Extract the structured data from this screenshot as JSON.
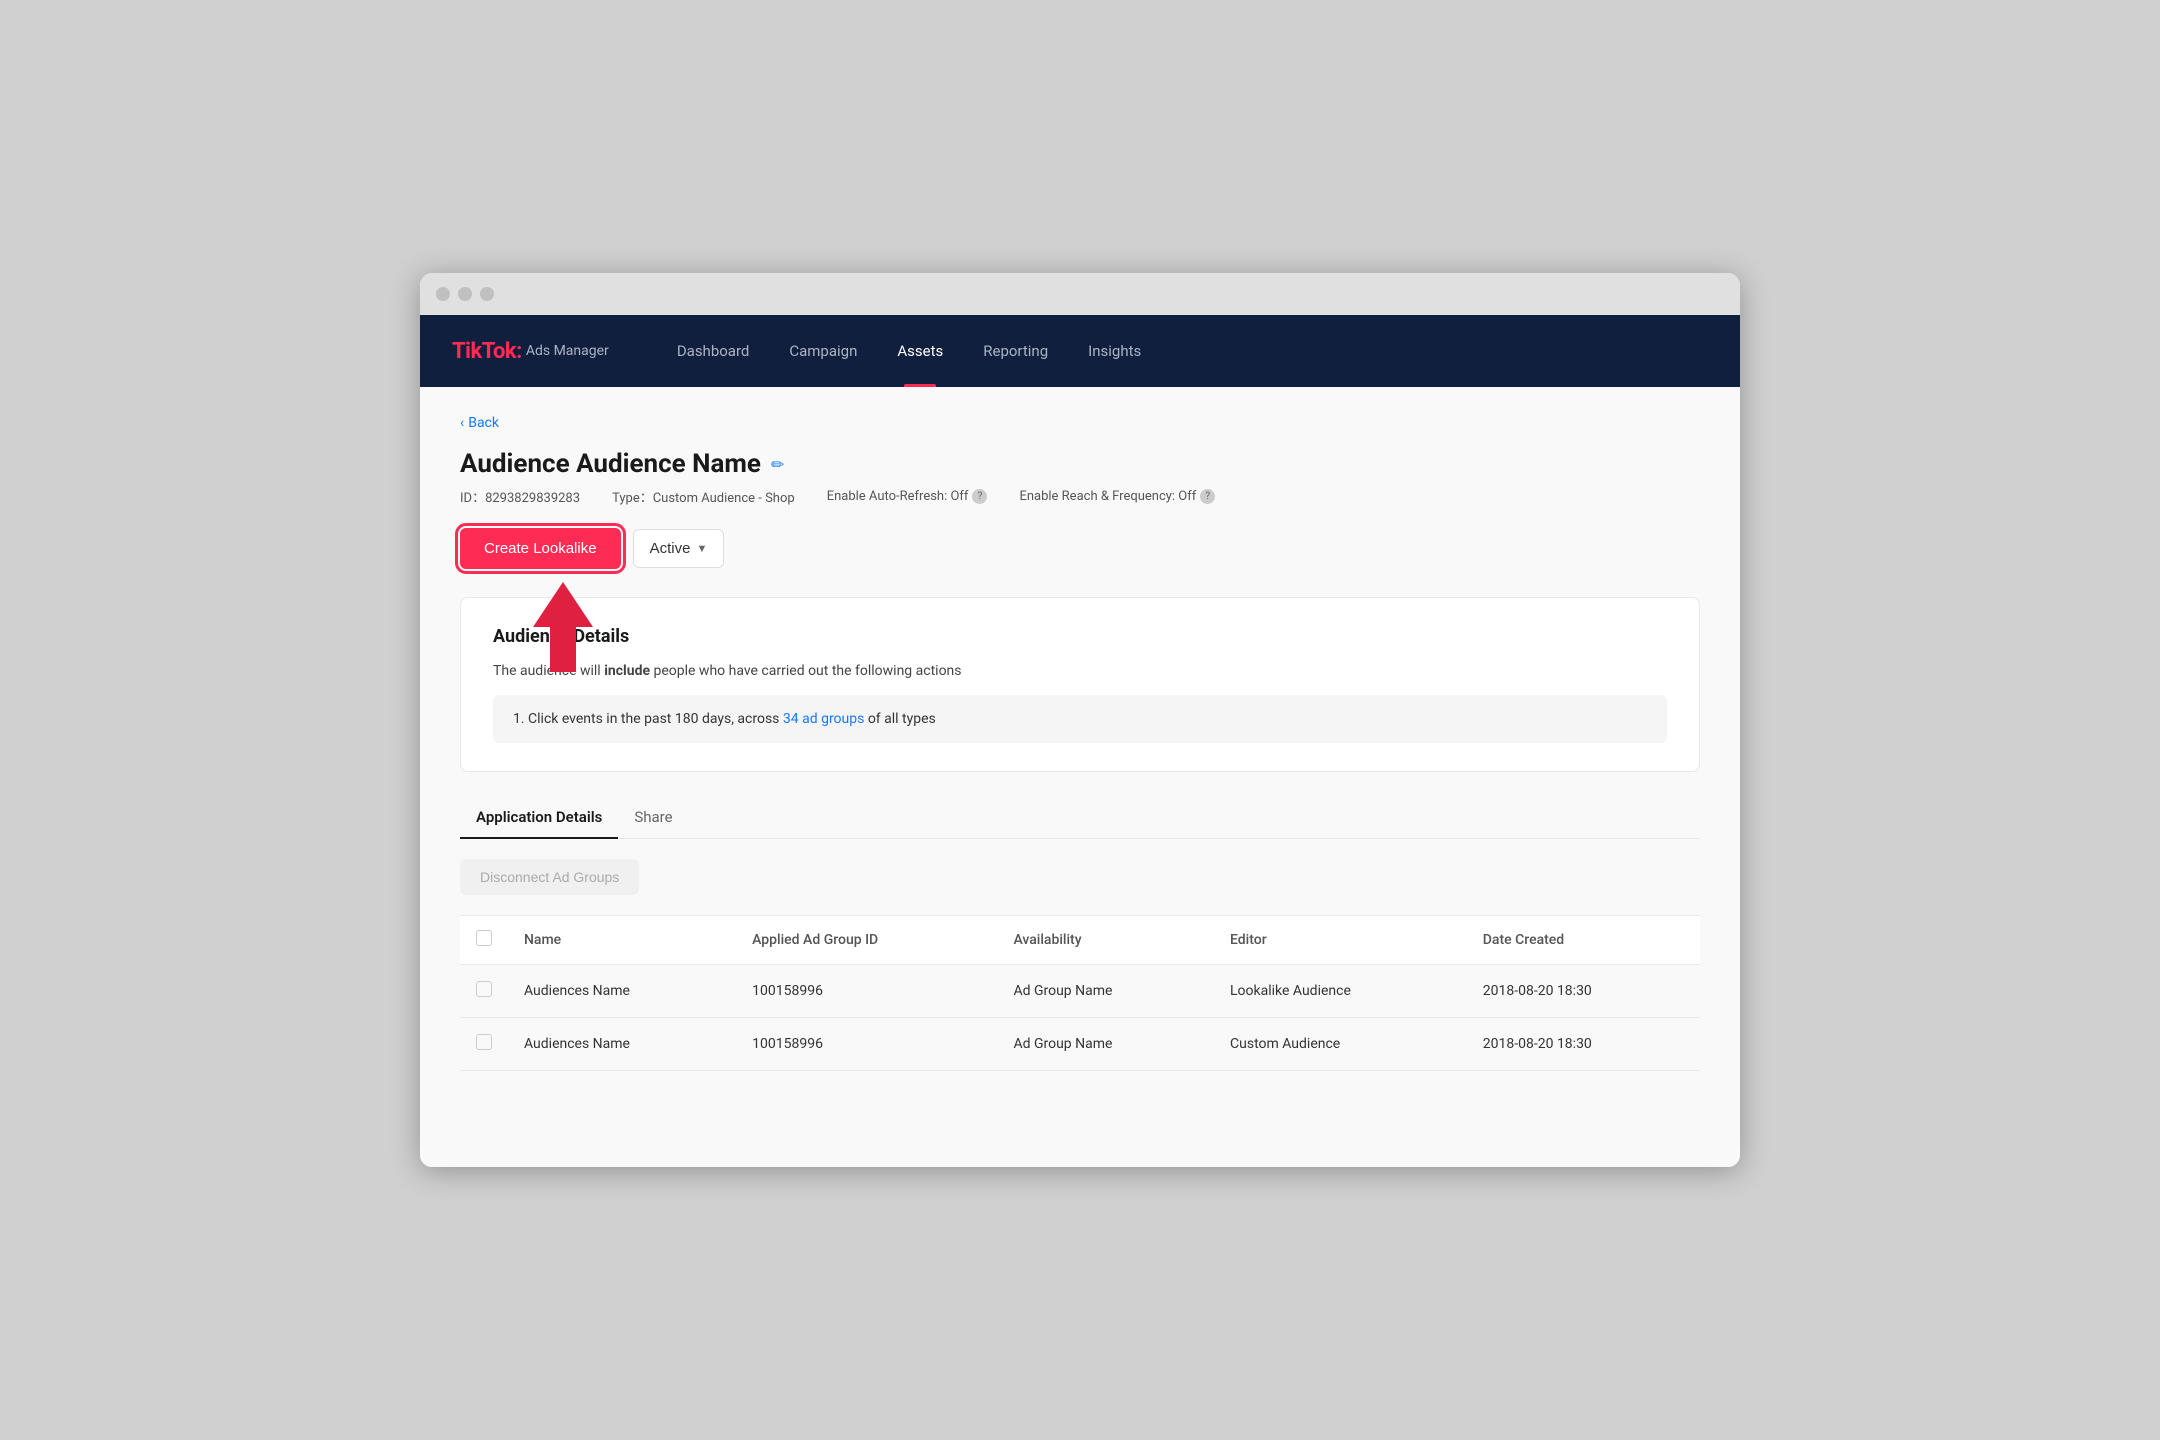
{
  "browser": {
    "traffic_lights": [
      "close",
      "minimize",
      "maximize"
    ]
  },
  "nav": {
    "logo": "TikTok",
    "logo_colon": ":",
    "logo_sub": "Ads Manager",
    "items": [
      {
        "label": "Dashboard",
        "active": false
      },
      {
        "label": "Campaign",
        "active": false
      },
      {
        "label": "Assets",
        "active": true
      },
      {
        "label": "Reporting",
        "active": false
      },
      {
        "label": "Insights",
        "active": false
      }
    ]
  },
  "page": {
    "back_label": "Back",
    "title": "Audience Audience Name",
    "edit_icon": "✏",
    "id_label": "ID：8293829839283",
    "type_label": "Type：Custom Audience - Shop",
    "auto_refresh_label": "Enable Auto-Refresh: Off",
    "reach_frequency_label": "Enable Reach & Frequency: Off",
    "create_lookalike_btn": "Create Lookalike",
    "active_btn": "Active",
    "audience_details_section": {
      "title": "Audience Details",
      "description_prefix": "The audience will ",
      "description_bold": "include",
      "description_suffix": " people who have carried out the following actions",
      "rule_prefix": "1. Click events in the past 180 days, across ",
      "rule_link": "34 ad groups",
      "rule_suffix": " of all types"
    },
    "tabs": [
      {
        "label": "Application Details",
        "active": true
      },
      {
        "label": "Share",
        "active": false
      }
    ],
    "disconnect_btn": "Disconnect Ad Groups",
    "table": {
      "columns": [
        {
          "label": "Name"
        },
        {
          "label": "Applied Ad Group ID"
        },
        {
          "label": "Availability"
        },
        {
          "label": "Editor"
        },
        {
          "label": "Date Created"
        }
      ],
      "rows": [
        {
          "name": "Audiences Name",
          "ad_group_id": "100158996",
          "availability": "Ad Group Name",
          "editor": "Lookalike Audience",
          "date_created": "2018-08-20 18:30"
        },
        {
          "name": "Audiences Name",
          "ad_group_id": "100158996",
          "availability": "Ad Group Name",
          "editor": "Custom Audience",
          "date_created": "2018-08-20 18:30"
        }
      ]
    }
  },
  "colors": {
    "nav_bg": "#0f1f3d",
    "accent_red": "#fe2c55",
    "link_blue": "#1677ff"
  }
}
